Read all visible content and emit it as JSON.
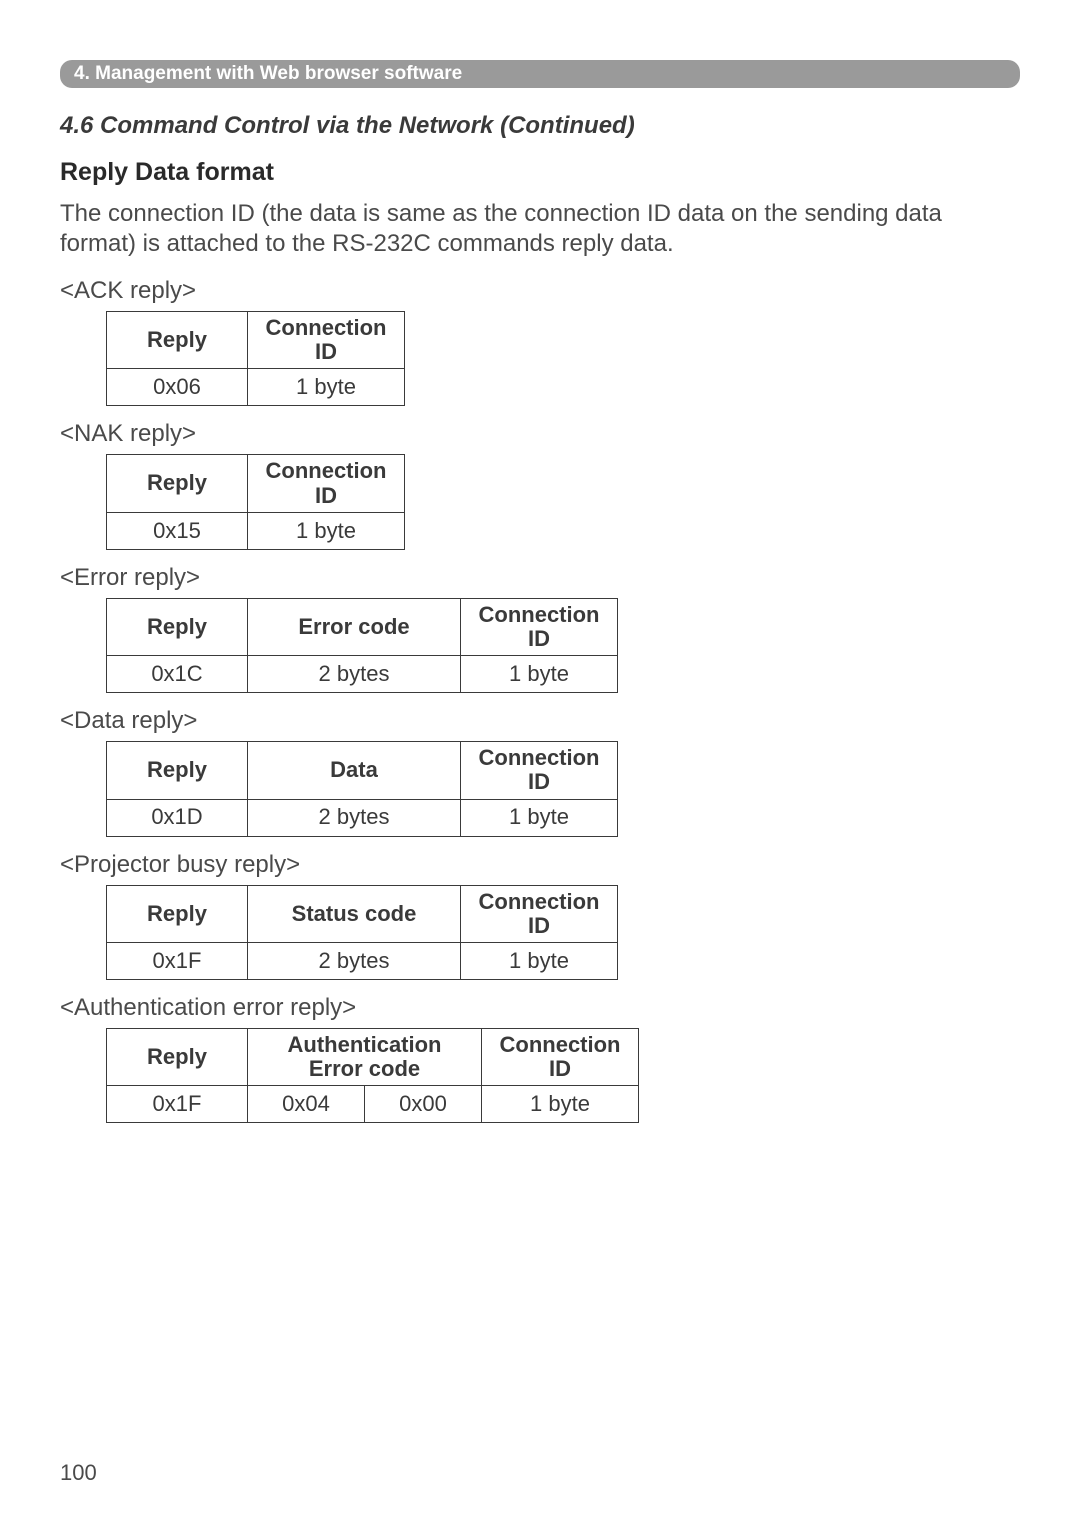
{
  "chapter_bar": "4. Management with Web browser software",
  "section_title": "4.6 Command Control via the Network (Continued)",
  "subheading": "Reply Data format",
  "intro_text": "The connection ID (the data is same as the connection ID data on the sending data format) is attached to the RS-232C commands reply data.",
  "tables": {
    "ack": {
      "label": "<ACK reply>",
      "headers": [
        "Reply",
        "Connection ID"
      ],
      "row": [
        "0x06",
        "1 byte"
      ]
    },
    "nak": {
      "label": "<NAK reply>",
      "headers": [
        "Reply",
        "Connection ID"
      ],
      "row": [
        "0x15",
        "1 byte"
      ]
    },
    "error": {
      "label": "<Error reply>",
      "headers": [
        "Reply",
        "Error code",
        "Connection ID"
      ],
      "row": [
        "0x1C",
        "2 bytes",
        "1 byte"
      ]
    },
    "data": {
      "label": "<Data reply>",
      "headers": [
        "Reply",
        "Data",
        "Connection ID"
      ],
      "row": [
        "0x1D",
        "2 bytes",
        "1 byte"
      ]
    },
    "busy": {
      "label": "<Projector busy reply>",
      "headers": [
        "Reply",
        "Status code",
        "Connection ID"
      ],
      "row": [
        "0x1F",
        "2 bytes",
        "1 byte"
      ]
    },
    "auth": {
      "label": "<Authentication error reply>",
      "headers": [
        "Reply",
        "Authentication Error code",
        "Connection ID"
      ],
      "row": [
        "0x1F",
        "0x04",
        "0x00",
        "1 byte"
      ]
    }
  },
  "page_number": "100"
}
